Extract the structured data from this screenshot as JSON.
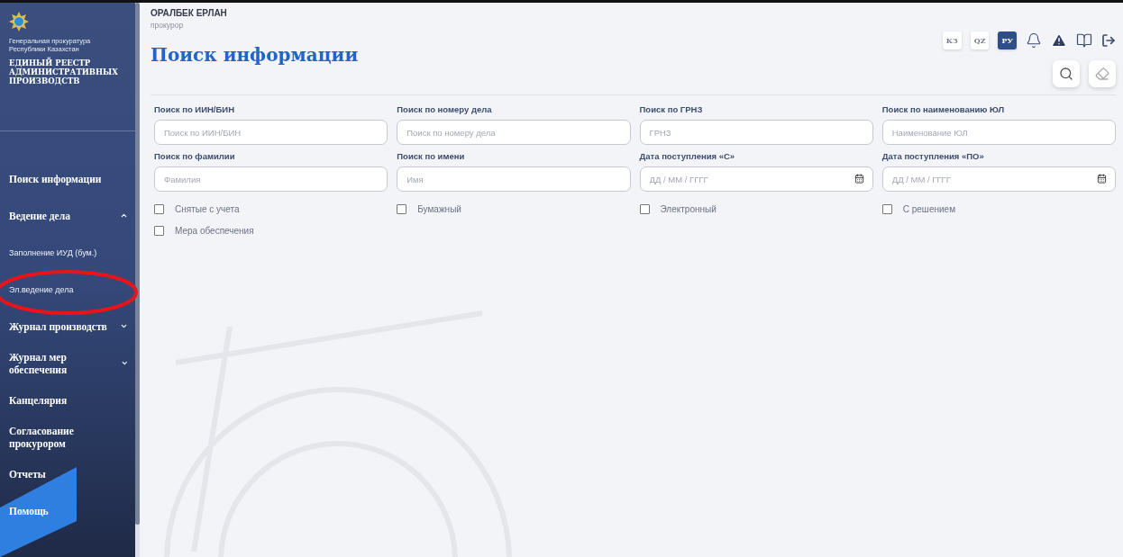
{
  "sidebar": {
    "org": "Генеральная прокуратура Республики Казахстан",
    "system": "ЕДИНЫЙ РЕЕСТР АДМИНИСТРАТИВНЫХ ПРОИЗВОДСТВ",
    "items": [
      {
        "label": "Поиск информации",
        "kind": "section"
      },
      {
        "label": "Ведение дела",
        "kind": "section",
        "expanded": true,
        "children": [
          {
            "label": "Заполнение ИУД (бум.)",
            "kind": "sub"
          },
          {
            "label": "Эл.ведение дела",
            "kind": "sub"
          }
        ]
      },
      {
        "label": "Журнал производств",
        "kind": "section",
        "expanded": false
      },
      {
        "label": "Журнал мер обеспечения",
        "kind": "section",
        "expanded": false
      },
      {
        "label": "Канцелярия",
        "kind": "section"
      },
      {
        "label": "Согласование прокурором",
        "kind": "section"
      },
      {
        "label": "Отчеты",
        "kind": "section"
      },
      {
        "label": "Помощь",
        "kind": "section"
      }
    ]
  },
  "user": {
    "name": "ОРАЛБЕК ЕРЛАН",
    "role": "прокурор"
  },
  "languages": [
    {
      "label": "КЗ",
      "selected": false
    },
    {
      "label": "QZ",
      "selected": false
    },
    {
      "label": "РУ",
      "selected": true
    }
  ],
  "page_title": "Поиск информации",
  "fields": [
    {
      "label": "Поиск по ИИН/БИН",
      "placeholder": "Поиск по ИИН/БИН",
      "kind": "text"
    },
    {
      "label": "Поиск по номеру дела",
      "placeholder": "Поиск по номеру дела",
      "kind": "text"
    },
    {
      "label": "Поиск по ГРНЗ",
      "placeholder": "ГРНЗ",
      "kind": "text"
    },
    {
      "label": "Поиск по наименованию ЮЛ",
      "placeholder": "Наименование ЮЛ",
      "kind": "text"
    },
    {
      "label": "Поиск по фамилии",
      "placeholder": "Фамилия",
      "kind": "text"
    },
    {
      "label": "Поиск по имени",
      "placeholder": "Имя",
      "kind": "text"
    },
    {
      "label": "Дата поступления «С»",
      "placeholder": "ДД / ММ / ГГГГ",
      "kind": "date"
    },
    {
      "label": "Дата поступления «ПО»",
      "placeholder": "ДД / ММ / ГГГГ",
      "kind": "date"
    }
  ],
  "checkboxes": [
    {
      "label": "Снятые с учета",
      "checked": false
    },
    {
      "label": "Бумажный",
      "checked": false
    },
    {
      "label": "Электронный",
      "checked": false
    },
    {
      "label": "С решением",
      "checked": false
    },
    {
      "label": "Мера обеспечения",
      "checked": false
    }
  ]
}
